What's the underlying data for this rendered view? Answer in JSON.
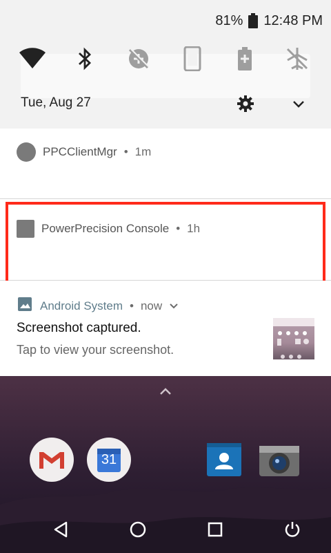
{
  "status_bar": {
    "battery_percent": "81%",
    "time": "12:48 PM"
  },
  "quick_settings": {
    "tiles": [
      "wifi-icon",
      "bluetooth-icon",
      "data-saver-icon",
      "rotate-icon",
      "battery-saver-icon",
      "airplane-mode-icon"
    ],
    "date": "Tue, Aug 27"
  },
  "notifications": [
    {
      "app_name": "PPCClientMgr",
      "separator": "•",
      "time": "1m"
    },
    {
      "app_name": "PowerPrecision Console",
      "separator": "•",
      "time": "1h"
    },
    {
      "app_name": "Android System",
      "separator": "•",
      "time": "now",
      "title": "Screenshot captured.",
      "body": "Tap to view your screenshot."
    }
  ],
  "colors": {
    "highlight": "#ff2a1a",
    "android_system_accent": "#607d8b"
  },
  "dock_apps": [
    "gmail-icon",
    "calendar-icon",
    "contacts-icon",
    "camera-icon"
  ],
  "calendar_day": "31",
  "nav": [
    "back-icon",
    "home-icon",
    "recents-icon",
    "power-icon"
  ]
}
